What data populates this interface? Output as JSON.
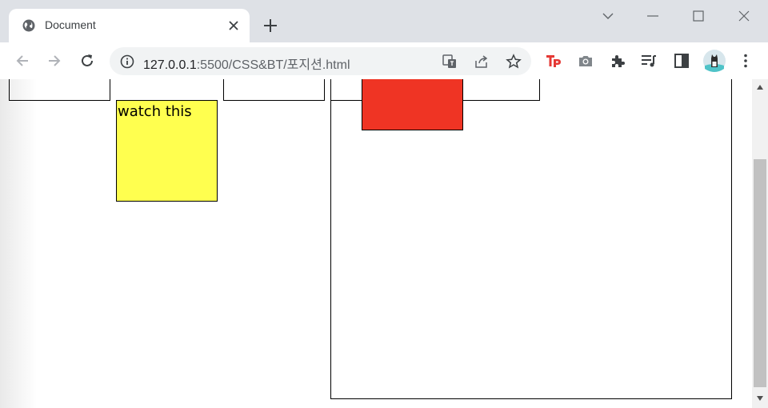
{
  "tab": {
    "title": "Document"
  },
  "address_bar": {
    "host": "127.0.0.1",
    "path": ":5500/CSS&BT/포지션.html"
  },
  "page": {
    "yellow_box_text": "watch this"
  },
  "colors": {
    "yellow_box": "#ffff4f",
    "red_box": "#ef3424",
    "tp_icon": "#e53935"
  },
  "toolbar_icons": [
    "back-icon",
    "forward-icon",
    "reload-icon",
    "info-icon",
    "translate-icon",
    "share-icon",
    "star-icon",
    "tp-extension-icon",
    "camera-icon",
    "extensions-icon",
    "media-icon",
    "side-panel-icon",
    "profile-avatar",
    "menu-icon"
  ]
}
